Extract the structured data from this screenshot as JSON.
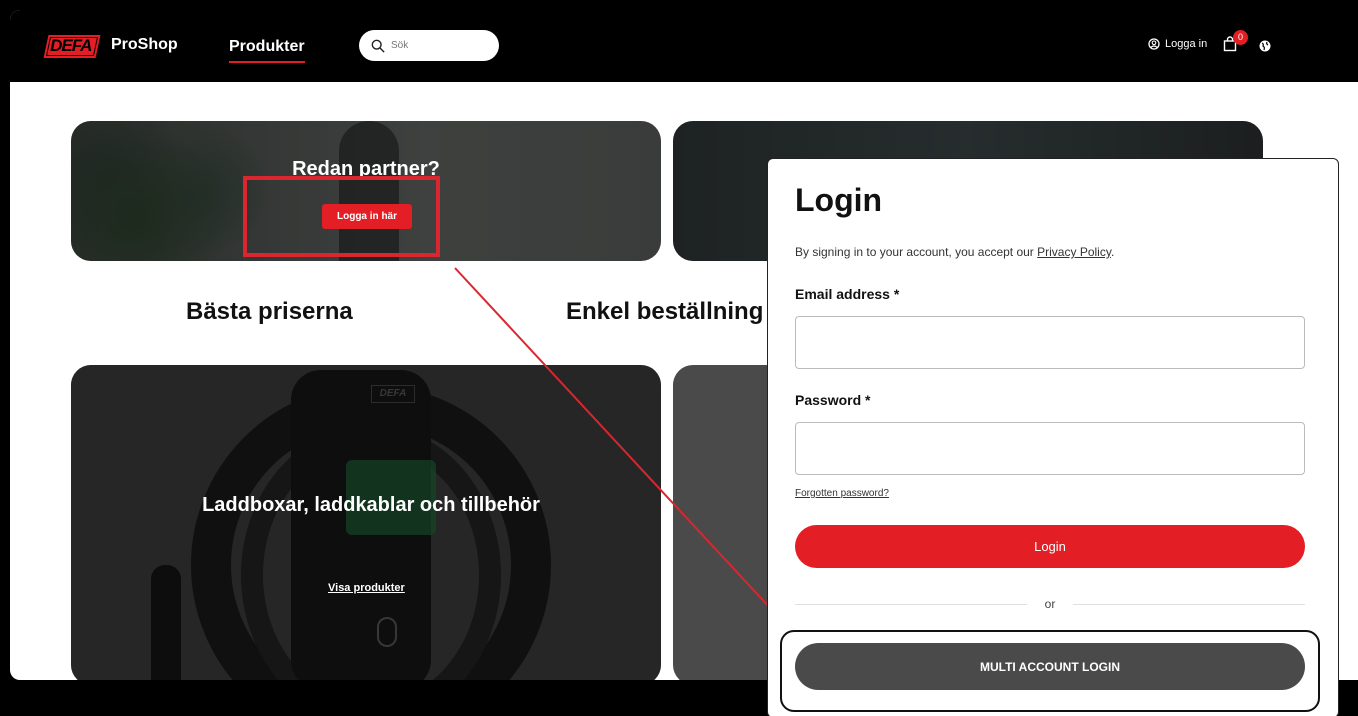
{
  "header": {
    "logo_text": "DEFA",
    "brand": "ProShop",
    "nav_products": "Produkter",
    "search_placeholder": "Sök",
    "login_link": "Logga in",
    "cart_count": "0"
  },
  "banners": {
    "partner_title": "Redan partner?",
    "partner_button": "Logga in här"
  },
  "features": [
    "Bästa priserna",
    "Enkel beställning"
  ],
  "categories": [
    {
      "title": "Laddboxar, laddkablar och tillbehör",
      "link": "Visa produkter",
      "box_logo": "DEFA"
    }
  ],
  "modal": {
    "title": "Login",
    "note_prefix": "By signing in to your account, you accept our ",
    "privacy_link": "Privacy Policy",
    "note_suffix": ".",
    "email_label": "Email address *",
    "password_label": "Password *",
    "forgot_link": "Forgotten password?",
    "login_button": "Login",
    "or_text": "or",
    "multi_button": "MULTI ACCOUNT LOGIN"
  },
  "colors": {
    "accent": "#e31e24",
    "header_bg": "#000000",
    "annotation": "#d9262f"
  },
  "icons": [
    "search-icon",
    "user-circle-icon",
    "shopping-bag-icon",
    "globe-icon"
  ]
}
